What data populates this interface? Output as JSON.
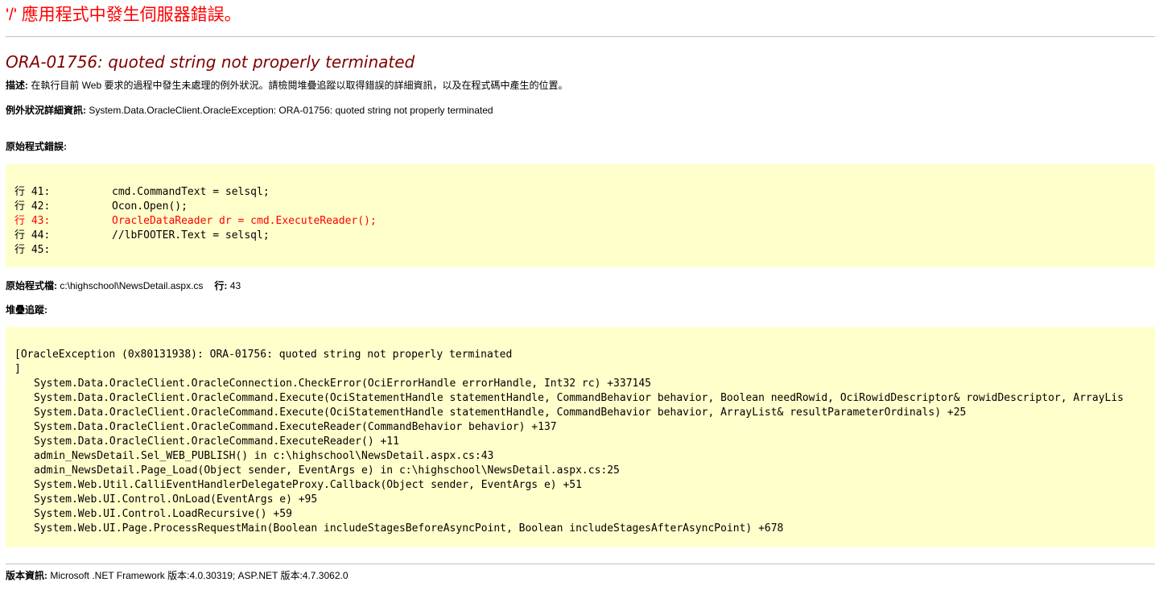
{
  "page": {
    "app_title": "'/' 應用程式中發生伺服器錯誤。",
    "error_title": "ORA-01756: quoted string not properly terminated",
    "description_label": "描述:",
    "description_text": "在執行目前 Web 要求的過程中發生未處理的例外狀況。請檢閱堆疊追蹤以取得錯誤的詳細資訊，以及在程式碼中產生的位置。",
    "exception_label": "例外狀況詳細資訊:",
    "exception_text": "System.Data.OracleClient.OracleException: ORA-01756: quoted string not properly terminated",
    "source_error_label": "原始程式錯誤:",
    "source_lines": [
      {
        "num": "行 41:",
        "code": "cmd.CommandText = selsql;"
      },
      {
        "num": "行 42:",
        "code": "Ocon.Open();"
      },
      {
        "num": "行 43:",
        "code": "OracleDataReader dr = cmd.ExecuteReader();"
      },
      {
        "num": "行 44:",
        "code": "//lbFOOTER.Text = selsql;"
      },
      {
        "num": "行 45:",
        "code": ""
      }
    ],
    "source_file_label": "原始程式檔:",
    "source_file": "c:\\highschool\\NewsDetail.aspx.cs",
    "line_label": "行:",
    "line_number": "43",
    "stack_trace_label": "堆疊追蹤:",
    "stack_header": "[OracleException (0x80131938): ORA-01756: quoted string not properly terminated",
    "stack_close": "]",
    "stack_frames": [
      "System.Data.OracleClient.OracleConnection.CheckError(OciErrorHandle errorHandle, Int32 rc) +337145",
      "System.Data.OracleClient.OracleCommand.Execute(OciStatementHandle statementHandle, CommandBehavior behavior, Boolean needRowid, OciRowidDescriptor& rowidDescriptor, ArrayLis",
      "System.Data.OracleClient.OracleCommand.Execute(OciStatementHandle statementHandle, CommandBehavior behavior, ArrayList& resultParameterOrdinals) +25",
      "System.Data.OracleClient.OracleCommand.ExecuteReader(CommandBehavior behavior) +137",
      "System.Data.OracleClient.OracleCommand.ExecuteReader() +11",
      "admin_NewsDetail.Sel_WEB_PUBLISH() in c:\\highschool\\NewsDetail.aspx.cs:43",
      "admin_NewsDetail.Page_Load(Object sender, EventArgs e) in c:\\highschool\\NewsDetail.aspx.cs:25",
      "System.Web.Util.CalliEventHandlerDelegateProxy.Callback(Object sender, EventArgs e) +51",
      "System.Web.UI.Control.OnLoad(EventArgs e) +95",
      "System.Web.UI.Control.LoadRecursive() +59",
      "System.Web.UI.Page.ProcessRequestMain(Boolean includeStagesBeforeAsyncPoint, Boolean includeStagesAfterAsyncPoint) +678"
    ],
    "version_label": "版本資訊:",
    "version_text": "Microsoft .NET Framework 版本:4.0.30319; ASP.NET 版本:4.7.3062.0"
  },
  "colors": {
    "app_title": "#ff0000",
    "error_title": "#800000",
    "code_background": "#ffffcc",
    "error_line": "#ff0000",
    "rule": "#c0c0c0"
  }
}
